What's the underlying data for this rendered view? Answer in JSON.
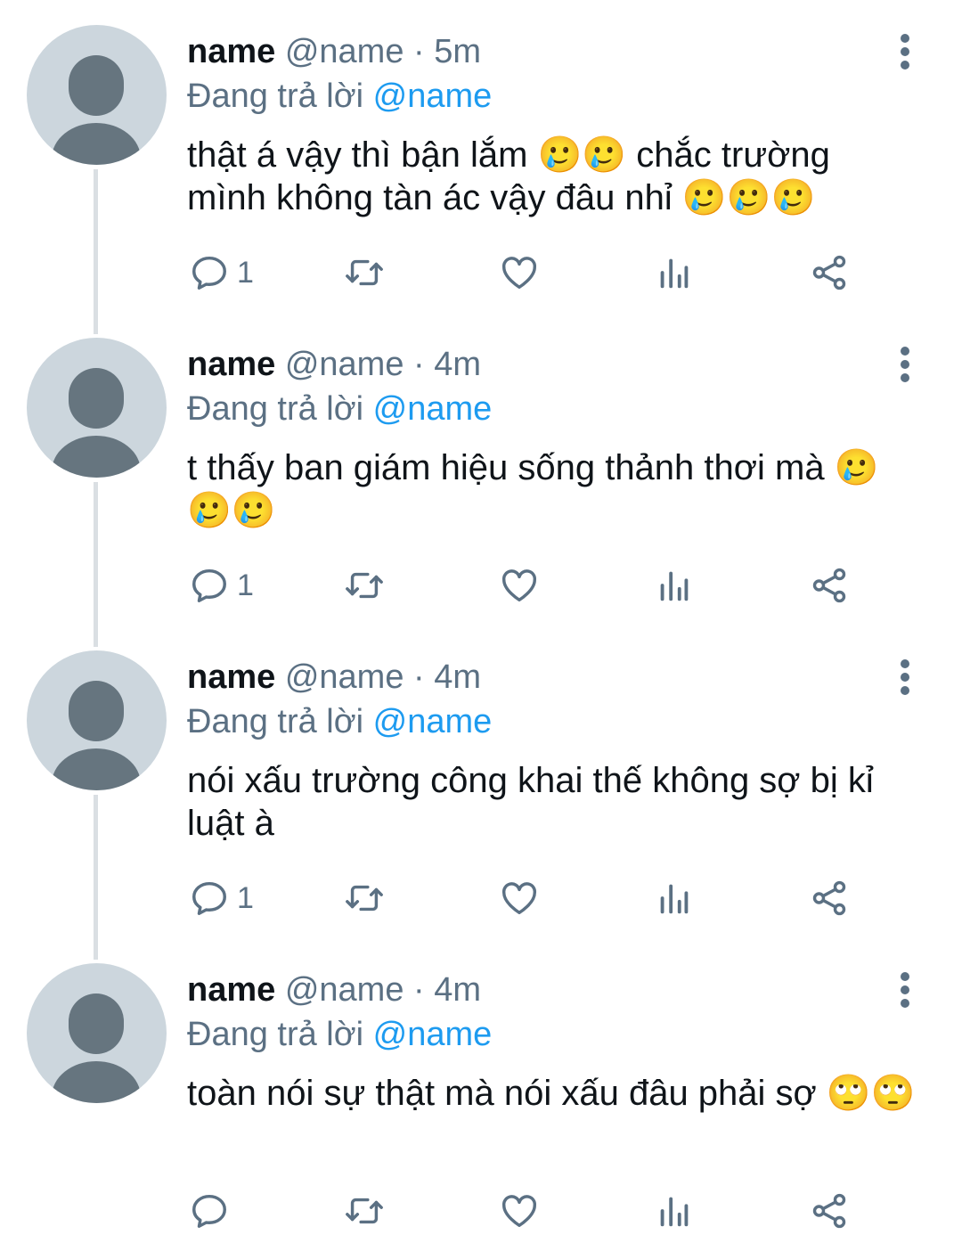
{
  "tweets": [
    {
      "display_name": "name",
      "handle": "@name",
      "separator": "·",
      "time": "5m",
      "replying_prefix": "Đang trả lời",
      "replying_to": "@name",
      "text": "thật á vậy thì bận lắm 🥲🥲 chắc trường mình không tàn ác vậy đâu nhỉ 🥲🥲🥲",
      "reply_count": "1"
    },
    {
      "display_name": "name",
      "handle": "@name",
      "separator": "·",
      "time": "4m",
      "replying_prefix": "Đang trả lời",
      "replying_to": "@name",
      "text": "t thấy ban giám hiệu sống thảnh thơi mà 🥲🥲🥲",
      "reply_count": "1"
    },
    {
      "display_name": "name",
      "handle": "@name",
      "separator": "·",
      "time": "4m",
      "replying_prefix": "Đang trả lời",
      "replying_to": "@name",
      "text": "nói xấu trường công khai thế không sợ bị kỉ luật à",
      "reply_count": "1"
    },
    {
      "display_name": "name",
      "handle": "@name",
      "separator": "·",
      "time": "4m",
      "replying_prefix": "Đang trả lời",
      "replying_to": "@name",
      "text": "toàn nói sự thật mà nói xấu đâu phải sợ 🙄🙄",
      "reply_count": ""
    }
  ],
  "icons": {
    "reply": "reply-icon",
    "retweet": "retweet-icon",
    "like": "heart-icon",
    "views": "views-icon",
    "share": "share-icon",
    "more": "more-vertical-icon"
  },
  "colors": {
    "secondary_text": "#5b7083",
    "mention": "#1d9bf0",
    "avatar_bg": "#ccd6dd",
    "avatar_fg": "#66757f",
    "thread_line": "#dadfe3"
  }
}
